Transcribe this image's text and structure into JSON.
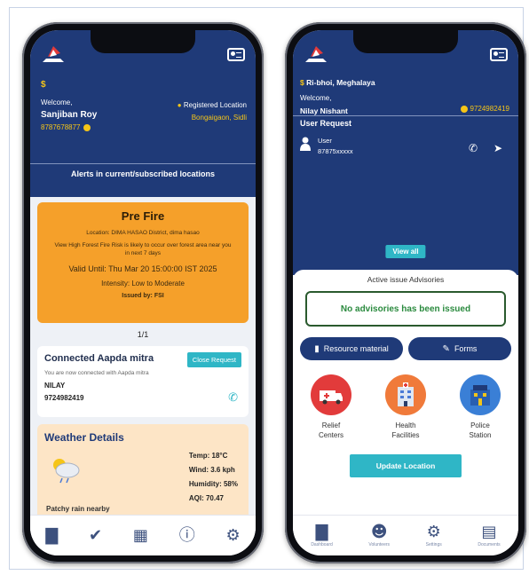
{
  "left": {
    "pin_symbol": "$",
    "welcome": "Welcome,",
    "user_name": "Sanjiban Roy",
    "phone": "8787678877",
    "location_label": "Registered Location",
    "location_value": "Bongaigaon, Sidli",
    "alerts_heading": "Alerts in current/subscribed locations",
    "alert": {
      "title": "Pre Fire",
      "location": "Location: DIMA HASAO District, dima hasao",
      "message": "View High Forest Fire Risk is likely to occur over forest area near you in next 7 days",
      "valid": "Valid Until: Thu Mar 20 15:00:00 IST 2025",
      "intensity": "Intensity: Low to Moderate",
      "issued": "Issued by: FSI"
    },
    "pager": "1/1",
    "mitra": {
      "title": "Connected Aapda mitra",
      "close_label": "Close Request",
      "subtitle": "You are now connected with Aapda mitra",
      "name": "NILAY",
      "phone": "9724982419"
    },
    "weather": {
      "title": "Weather Details",
      "condition": "Patchy rain nearby",
      "temp": "Temp: 18°C",
      "wind": "Wind: 3.6 kph",
      "humidity": "Humidity: 58%",
      "aqi": "AQI: 70.47"
    },
    "nav_icons": [
      "bar-chart-icon",
      "check-circle-icon",
      "map-icon",
      "info-icon",
      "gear-icon"
    ]
  },
  "right": {
    "pin_symbol": "$",
    "location": "Ri-bhoi, Meghalaya",
    "welcome": "Welcome,",
    "user_name": "Nilay Nishant",
    "phone": "9724982419",
    "user_request_heading": "User Request",
    "request_user_label": "User",
    "request_user_phone": "87875xxxxx",
    "view_all": "View all",
    "advisories_heading": "Active issue Advisories",
    "no_advisories": "No advisories has been issued",
    "resource_label": "Resource material",
    "forms_label": "Forms",
    "relief_label_1": "Relief",
    "relief_label_2": "Centers",
    "health_label_1": "Health",
    "health_label_2": "Facilities",
    "police_label_1": "Police",
    "police_label_2": "Station",
    "update_location": "Update Location",
    "nav": [
      {
        "label": "Dashboard",
        "icon": "bar-chart-icon"
      },
      {
        "label": "Volunteers",
        "icon": "people-icon"
      },
      {
        "label": "Settings",
        "icon": "gear-icon"
      },
      {
        "label": "Documents",
        "icon": "document-icon"
      }
    ]
  },
  "colors": {
    "navy": "#1f3a78",
    "orange": "#f5a02a",
    "teal": "#2fb6c6",
    "green": "#2a8a3e",
    "yellow": "#f5c518"
  }
}
